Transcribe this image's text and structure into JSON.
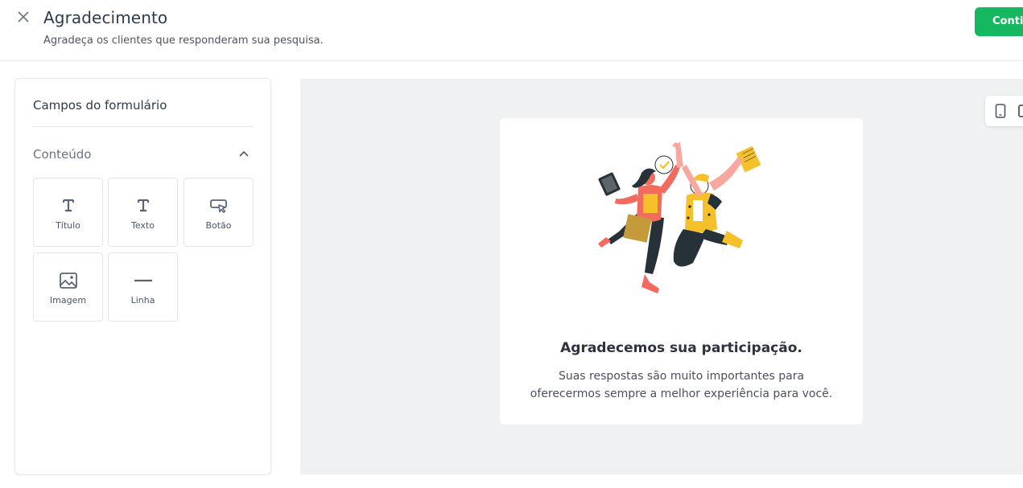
{
  "header": {
    "title": "Agradecimento",
    "subtitle": "Agradeça os clientes que responderam sua pesquisa.",
    "continue_label": "Continuar",
    "close_icon": "close-icon"
  },
  "sidebar": {
    "title": "Campos do formulário",
    "section": {
      "label": "Conteúdo",
      "expanded": true,
      "icon": "chevron-up-icon"
    },
    "fields": [
      {
        "label": "Título",
        "icon": "title-icon"
      },
      {
        "label": "Texto",
        "icon": "text-icon"
      },
      {
        "label": "Botão",
        "icon": "button-cursor-icon"
      },
      {
        "label": "Imagem",
        "icon": "image-icon"
      },
      {
        "label": "Linha",
        "icon": "line-icon"
      }
    ]
  },
  "preview": {
    "devices": [
      "tablet-icon",
      "desktop-icon"
    ],
    "card": {
      "title": "Agradecemos sua participação.",
      "text_line1": "Suas respostas são muito importantes para",
      "text_line2": "oferecermos sempre a melhor experiência para você."
    }
  },
  "colors": {
    "accent": "#16b85f",
    "canvas_bg": "#f0f1f2",
    "illustration_coral": "#f36b5f",
    "illustration_yellow": "#f5c02a",
    "illustration_dark": "#263238"
  }
}
